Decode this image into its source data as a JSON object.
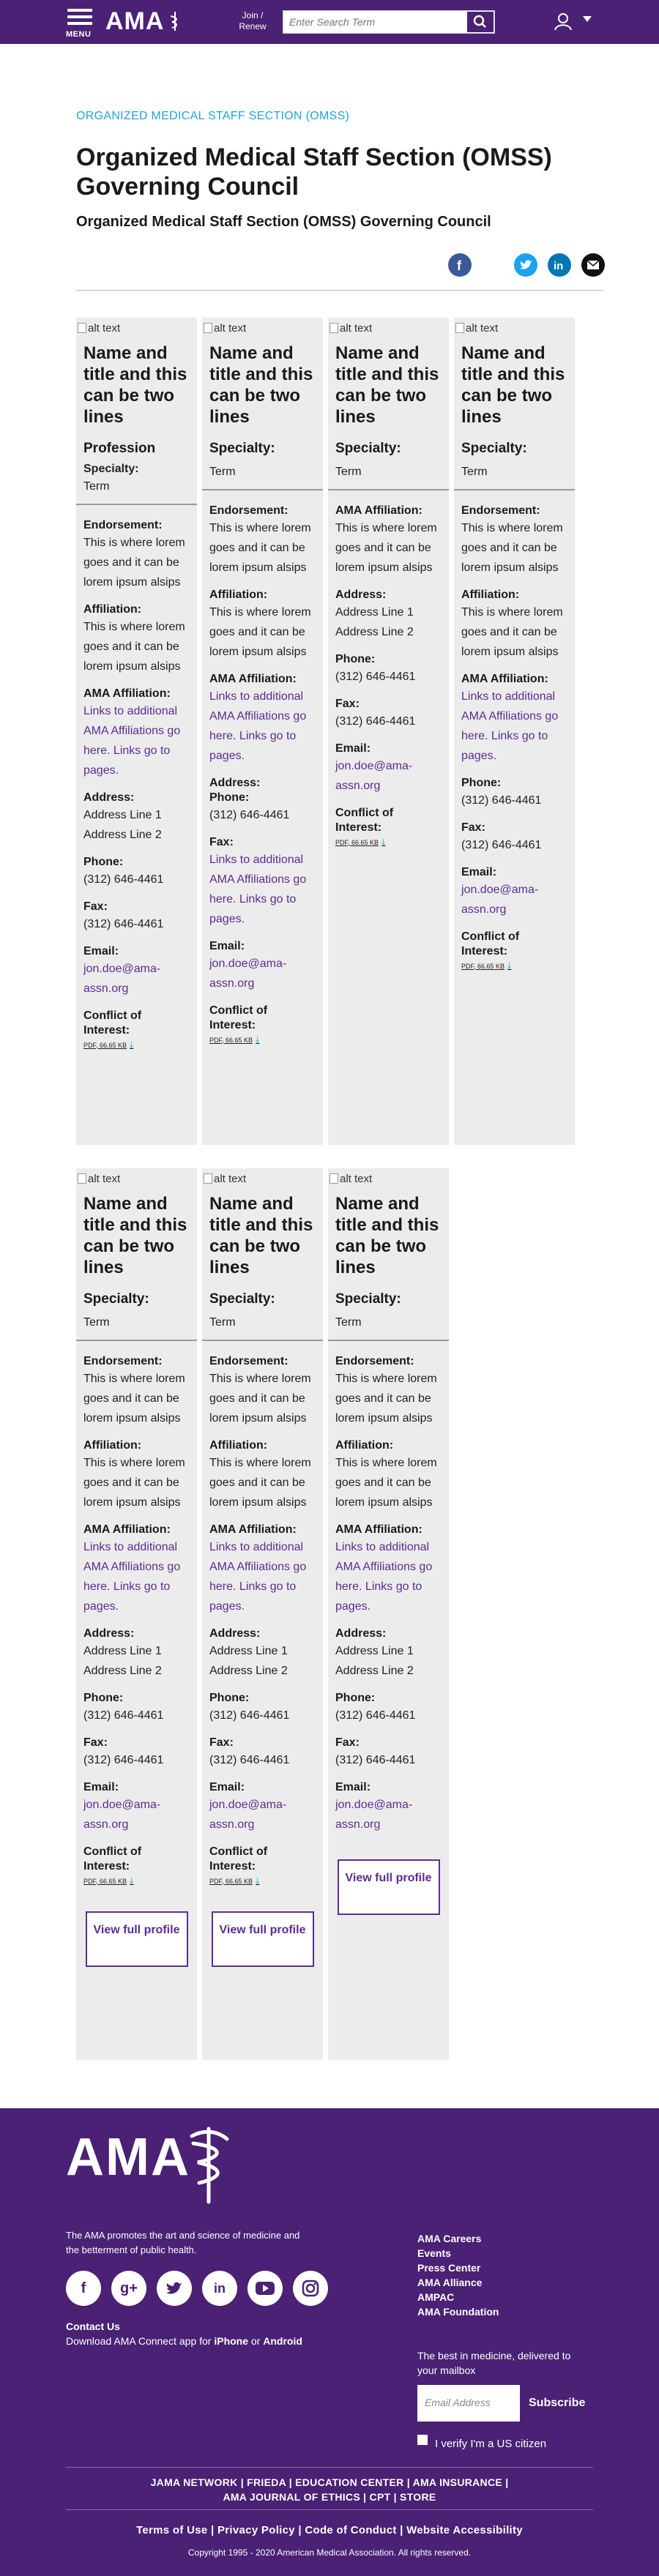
{
  "header": {
    "menu_label": "MENU",
    "logo": "AMA",
    "join_label": "Join / Renew",
    "search_placeholder": "Enter Search Term"
  },
  "breadcrumb": "ORGANIZED MEDICAL STAFF SECTION (OMSS)",
  "page_title": "Organized Medical Staff Section (OMSS) Governing Council",
  "page_subtitle": "Organized Medical Staff Section (OMSS) Governing Council",
  "share_icons": [
    "facebook-icon",
    "twitter-icon",
    "linkedin-icon",
    "email-icon"
  ],
  "labels": {
    "alt": "alt text",
    "endorsement": "Endorsement:",
    "affiliation": "Affiliation:",
    "ama_affiliation": "AMA Affiliation:",
    "address": "Address:",
    "phone": "Phone:",
    "fax": "Fax:",
    "email": "Email:",
    "conflict": "Conflict of Interest:",
    "profession": "Profession",
    "specialty": "Specialty:",
    "view": "View full profile"
  },
  "values": {
    "name": "Name and title and this can be two lines",
    "term": "Term",
    "lorem": "This is where lorem goes and it can be lorem ipsum alsips",
    "ama_links": "Links to additional AMA Affiliations go here. Links go to pages.",
    "address1": "Address Line 1",
    "address2": "Address Line 2",
    "phone": "(312) 646-4461",
    "fax": "(312) 646-4461",
    "email": "jon.doe@ama-assn.org",
    "pdf": "PDF, 66.65 KB"
  },
  "footer": {
    "logo": "AMA",
    "mission": "The AMA promotes the art and science of medicine and the betterment of public health.",
    "contact": "Contact Us",
    "app_prefix": "Download AMA Connect app for ",
    "app_iphone": "iPhone",
    "app_or": " or ",
    "app_android": "Android",
    "links": [
      "AMA Careers",
      "Events",
      "Press Center",
      "AMA Alliance",
      "AMPAC",
      "AMA Foundation"
    ],
    "newsletter": "The best in medicine, delivered to your mailbox",
    "email_placeholder": "Email Address",
    "subscribe": "Subscribe",
    "verify": "I verify I'm a US citizen",
    "nav1": "JAMA NETWORK  |  FRIEDA  |  EDUCATION CENTER  |  AMA INSURANCE  |",
    "nav2": "AMA JOURNAL OF ETHICS  |  CPT  |  STORE",
    "legal": "Terms of Use  |  Privacy Policy  |  Code of Conduct  |  Website Accessibility",
    "copyright": "Copyright 1995 - 2020 American Medical Association. All rights reserved.",
    "social_icons": [
      "facebook-icon",
      "google-plus-icon",
      "twitter-icon",
      "linkedin-icon",
      "youtube-icon",
      "instagram-icon"
    ]
  }
}
